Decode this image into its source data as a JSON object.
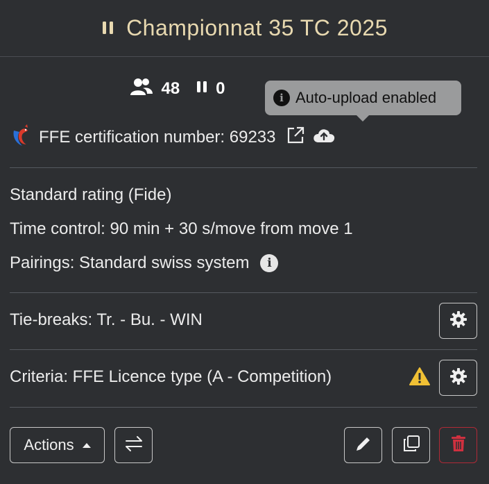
{
  "header": {
    "title": "Championnat 35 TC 2025",
    "status_icon": "pause-icon",
    "title_color": "#e8d9b0"
  },
  "stats": {
    "players_count": "48",
    "rounds_partial": "0"
  },
  "tooltip": {
    "text": "Auto-upload enabled"
  },
  "certification": {
    "label": "FFE certification number: 69233"
  },
  "details": {
    "rating": "Standard rating (Fide)",
    "time_control": "Time control: 90 min + 30 s/move from move 1",
    "pairings": "Pairings: Standard swiss system"
  },
  "tiebreaks": {
    "label": "Tie-breaks: Tr. - Bu. - WIN"
  },
  "criteria": {
    "label": "Criteria: FFE Licence type (A - Competition)"
  },
  "toolbar": {
    "actions_label": "Actions"
  },
  "colors": {
    "background": "#2d2f32",
    "warning": "#f0c034",
    "danger": "#b02a37"
  }
}
